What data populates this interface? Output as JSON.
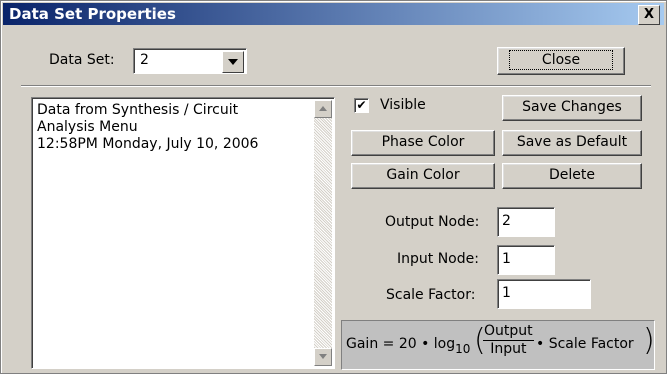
{
  "window": {
    "title": "Data Set Properties",
    "close_glyph": "X"
  },
  "data_set": {
    "label": "Data Set:",
    "value": "2"
  },
  "buttons": {
    "close": "Close",
    "save_changes": "Save Changes",
    "phase_color": "Phase Color",
    "save_as_default": "Save as Default",
    "gain_color": "Gain Color",
    "delete": "Delete"
  },
  "description": "Data from Synthesis / Circuit\nAnalysis Menu\n12:58PM Monday, July 10, 2006",
  "visible": {
    "label": "Visible",
    "checked": true,
    "mark": "✔"
  },
  "fields": {
    "output_node": {
      "label": "Output Node:",
      "value": "2"
    },
    "input_node": {
      "label": "Input Node:",
      "value": "1"
    },
    "scale_factor": {
      "label": "Scale Factor:",
      "value": "1"
    }
  },
  "formula": {
    "prefix": "Gain = 20 • log",
    "subscript": "10",
    "open_paren": "(",
    "numerator": "Output",
    "denominator": "Input",
    "suffix": "• Scale Factor",
    "close_paren": ")"
  }
}
